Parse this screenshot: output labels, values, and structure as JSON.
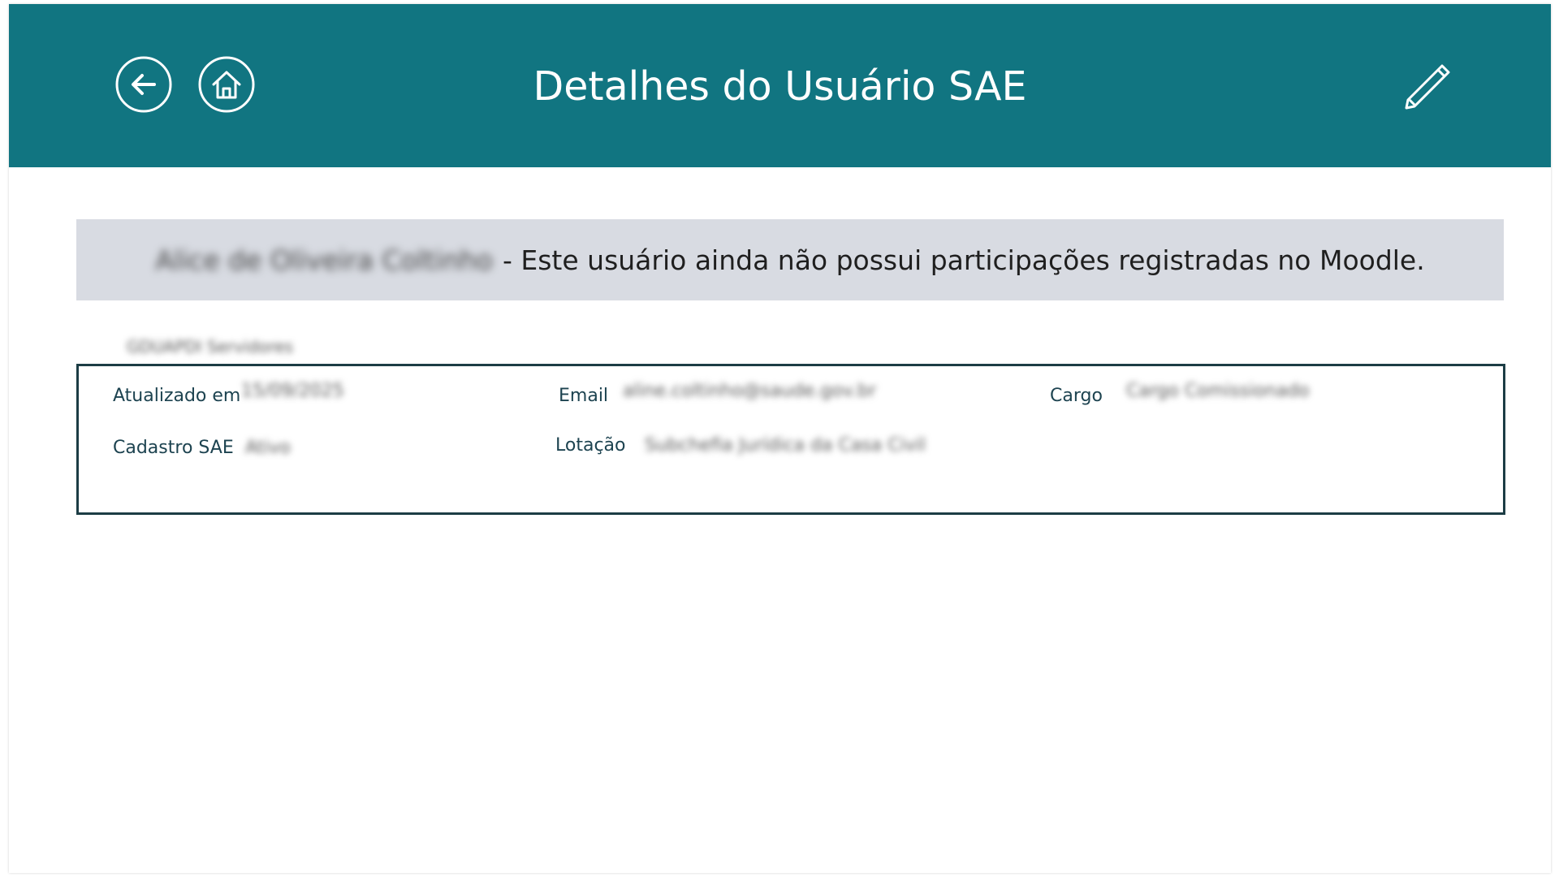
{
  "header": {
    "title": "Detalhes do Usuário SAE",
    "background_color": "#117581",
    "back_icon": "arrow-left-circle-icon",
    "home_icon": "home-circle-icon",
    "edit_icon": "pencil-icon"
  },
  "notice": {
    "user_name": "Alice de Oliveira Coltinho",
    "message": "- Este usuário ainda não possui participações registradas no Moodle.",
    "background_color": "#d8dbe2"
  },
  "group": {
    "label": "GDUAPDI Servidores"
  },
  "details": {
    "updated_label": "Atualizado em",
    "updated_value": "15/09/2025",
    "email_label": "Email",
    "email_value": "aline.coltinho@saude.gov.br",
    "cargo_label": "Cargo",
    "cargo_value": "Cargo Comissionado",
    "cadastro_label": "Cadastro SAE",
    "cadastro_value": "Ativo",
    "lotacao_label": "Lotação",
    "lotacao_value": "Subchefia Jurídica da Casa Civil",
    "border_color": "#1c3d45"
  }
}
